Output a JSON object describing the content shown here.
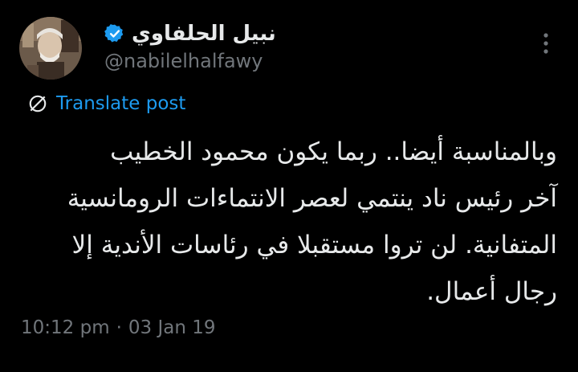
{
  "author": {
    "display_name": "نبيل الحلفاوي",
    "handle": "@nabilelhalfawy",
    "verified": true,
    "avatar": "avatar-photo"
  },
  "translate": {
    "label": "Translate post",
    "icon": "translate-globe-icon"
  },
  "tweet": {
    "lines": [
      "وبالمناسبة أيضا.. ربما يكون محمود الخطيب",
      "آخر رئيس ناد ينتمي لعصر الانتماءات الرومانسية",
      "المتفانية. لن تروا مستقبلا في رئاسات الأندية إلا",
      "رجال أعمال."
    ]
  },
  "meta": {
    "time": "10:12 pm",
    "separator": "·",
    "date": "03 Jan 19"
  },
  "colors": {
    "background": "#000000",
    "text": "#e7e9ea",
    "muted": "#71767b",
    "accent": "#1d9bf0"
  }
}
